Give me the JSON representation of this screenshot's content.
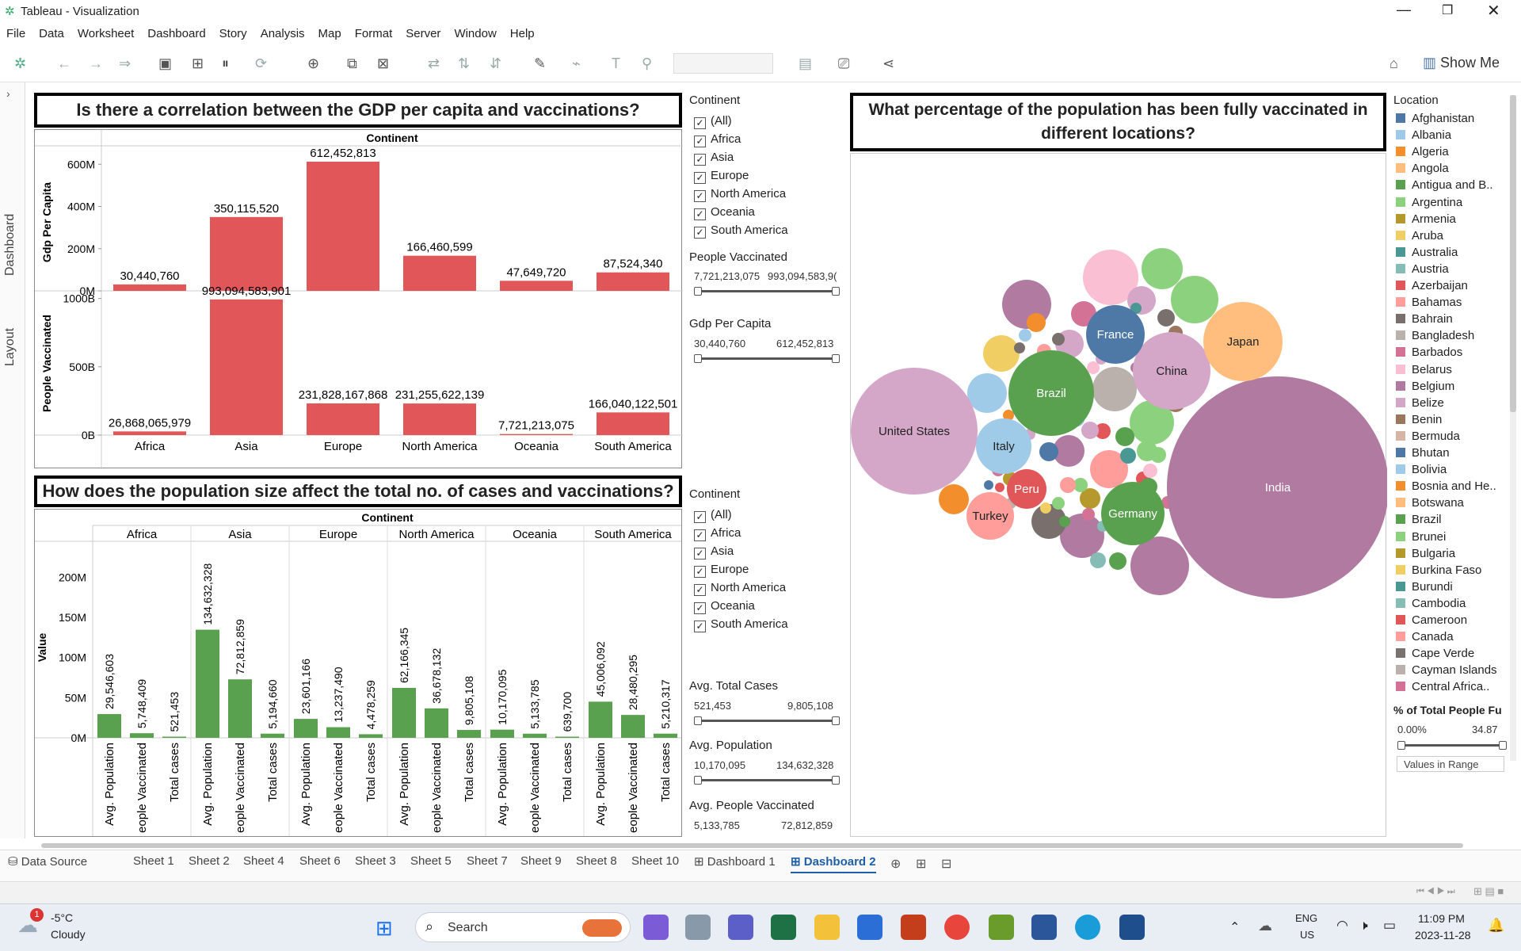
{
  "window": {
    "app_icon": "tableau-icon",
    "title": "Tableau - Visualization",
    "controls": [
      "minimize-icon",
      "restore-icon",
      "close-icon"
    ]
  },
  "menu": [
    "File",
    "Data",
    "Worksheet",
    "Dashboard",
    "Story",
    "Analysis",
    "Map",
    "Format",
    "Server",
    "Window",
    "Help"
  ],
  "toolbar": {
    "show_me": "Show Me"
  },
  "side_tabs": {
    "dashboard": "Dashboard",
    "layout": "Layout"
  },
  "viz1": {
    "title": "Is there a correlation between the GDP per capita and  vaccinations?",
    "header": "Continent",
    "chart_data": {
      "type": "bar",
      "categories": [
        "Africa",
        "Asia",
        "Europe",
        "North America",
        "Oceania",
        "South America"
      ],
      "series": [
        {
          "name": "Gdp Per Capita",
          "values": [
            30440760,
            350115520,
            612452813,
            166460599,
            47649720,
            87524340
          ],
          "labels": [
            "30,440,760",
            "350,115,520",
            "612,452,813",
            "166,460,599",
            "47,649,720",
            "87,524,340"
          ],
          "ticks": [
            "600M",
            "400M",
            "200M",
            "0M"
          ],
          "ymax": 650000000
        },
        {
          "name": "People Vaccinated",
          "values": [
            26868065979,
            993094583901,
            231828167868,
            231255622139,
            7721213075,
            166040122501
          ],
          "labels": [
            "26,868,065,979",
            "993,094,583,901",
            "231,828,167,868",
            "231,255,622,139",
            "7,721,213,075",
            "166,040,122,501"
          ],
          "ticks": [
            "1000B",
            "500B",
            "0B"
          ],
          "ymax": 1050000000000
        }
      ],
      "color": "#e15759"
    }
  },
  "viz2": {
    "title": "How does the population size affect the total no. of cases and vaccinations?",
    "header": "Continent",
    "ylabel": "Value",
    "chart_data": {
      "type": "bar",
      "categories": [
        "Africa",
        "Asia",
        "Europe",
        "North America",
        "Oceania",
        "South America"
      ],
      "measures": [
        "Avg. Population",
        "eople Vaccinated",
        "Total cases"
      ],
      "values": [
        [
          29546603,
          5748409,
          521453
        ],
        [
          134632328,
          72812859,
          5194660
        ],
        [
          23601166,
          13237490,
          4478259
        ],
        [
          62166345,
          36678132,
          9805108
        ],
        [
          10170095,
          5133785,
          639700
        ],
        [
          45006092,
          28480295,
          5210317
        ]
      ],
      "labels": [
        [
          "29,546,603",
          "5,748,409",
          "521,453"
        ],
        [
          "134,632,328",
          "72,812,859",
          "5,194,660"
        ],
        [
          "23,601,166",
          "13,237,490",
          "4,478,259"
        ],
        [
          "62,166,345",
          "36,678,132",
          "9,805,108"
        ],
        [
          "10,170,095",
          "5,133,785",
          "639,700"
        ],
        [
          "45,006,092",
          "28,480,295",
          "5,210,317"
        ]
      ],
      "ticks": [
        "200M",
        "150M",
        "100M",
        "50M",
        "0M"
      ],
      "ymax": 225000000,
      "color": "#59a14f"
    }
  },
  "filters1": {
    "continent_label": "Continent",
    "continents": [
      "(All)",
      "Africa",
      "Asia",
      "Europe",
      "North America",
      "Oceania",
      "South America"
    ],
    "people_vacc": {
      "label": "People Vaccinated",
      "min": "7,721,213,075",
      "max": "993,094,583,9("
    },
    "gdp": {
      "label": "Gdp Per Capita",
      "min": "30,440,760",
      "max": "612,452,813"
    }
  },
  "filters2": {
    "continent_label": "Continent",
    "continents": [
      "(All)",
      "Africa",
      "Asia",
      "Europe",
      "North America",
      "Oceania",
      "South America"
    ],
    "total_cases": {
      "label": "Avg. Total Cases",
      "min": "521,453",
      "max": "9,805,108"
    },
    "population": {
      "label": "Avg. Population",
      "min": "10,170,095",
      "max": "134,632,328"
    },
    "people_vacc": {
      "label": "Avg. People Vaccinated",
      "min": "5,133,785",
      "max": "72,812,859"
    }
  },
  "viz3": {
    "title": "What percentage of the population has been fully vaccinated in different locations?",
    "bubbles": [
      {
        "label": "India",
        "color": "#b07aa1"
      },
      {
        "label": "United States",
        "color": "#d4a6c8"
      },
      {
        "label": "Brazil",
        "color": "#59a14f"
      },
      {
        "label": "China",
        "color": "#d4a6c8"
      },
      {
        "label": "Japan",
        "color": "#ffbe7d"
      },
      {
        "label": "France",
        "color": "#4e79a7"
      },
      {
        "label": "Germany",
        "color": "#59a14f"
      },
      {
        "label": "Italy",
        "color": "#a0cbe8"
      },
      {
        "label": "Turkey",
        "color": "#ff9d9a"
      },
      {
        "label": "Peru",
        "color": "#e15759"
      }
    ]
  },
  "legend": {
    "title": "Location",
    "items": [
      {
        "name": "Afghanistan",
        "color": "#4e79a7"
      },
      {
        "name": "Albania",
        "color": "#a0cbe8"
      },
      {
        "name": "Algeria",
        "color": "#f28e2b"
      },
      {
        "name": "Angola",
        "color": "#ffbe7d"
      },
      {
        "name": "Antigua and B..",
        "color": "#59a14f"
      },
      {
        "name": "Argentina",
        "color": "#8cd17d"
      },
      {
        "name": "Armenia",
        "color": "#b6992d"
      },
      {
        "name": "Aruba",
        "color": "#f1ce63"
      },
      {
        "name": "Australia",
        "color": "#499894"
      },
      {
        "name": "Austria",
        "color": "#86bcb6"
      },
      {
        "name": "Azerbaijan",
        "color": "#e15759"
      },
      {
        "name": "Bahamas",
        "color": "#ff9d9a"
      },
      {
        "name": "Bahrain",
        "color": "#79706e"
      },
      {
        "name": "Bangladesh",
        "color": "#bab0ac"
      },
      {
        "name": "Barbados",
        "color": "#d37295"
      },
      {
        "name": "Belarus",
        "color": "#fabfd2"
      },
      {
        "name": "Belgium",
        "color": "#b07aa1"
      },
      {
        "name": "Belize",
        "color": "#d4a6c8"
      },
      {
        "name": "Benin",
        "color": "#9d7660"
      },
      {
        "name": "Bermuda",
        "color": "#d7b5a6"
      },
      {
        "name": "Bhutan",
        "color": "#4e79a7"
      },
      {
        "name": "Bolivia",
        "color": "#a0cbe8"
      },
      {
        "name": "Bosnia and He..",
        "color": "#f28e2b"
      },
      {
        "name": "Botswana",
        "color": "#ffbe7d"
      },
      {
        "name": "Brazil",
        "color": "#59a14f"
      },
      {
        "name": "Brunei",
        "color": "#8cd17d"
      },
      {
        "name": "Bulgaria",
        "color": "#b6992d"
      },
      {
        "name": "Burkina Faso",
        "color": "#f1ce63"
      },
      {
        "name": "Burundi",
        "color": "#499894"
      },
      {
        "name": "Cambodia",
        "color": "#86bcb6"
      },
      {
        "name": "Cameroon",
        "color": "#e15759"
      },
      {
        "name": "Canada",
        "color": "#ff9d9a"
      },
      {
        "name": "Cape Verde",
        "color": "#79706e"
      },
      {
        "name": "Cayman Islands",
        "color": "#bab0ac"
      },
      {
        "name": "Central Africa..",
        "color": "#d37295"
      }
    ],
    "pct_title": "% of Total People Fu",
    "pct_min": "0.00%",
    "pct_max": "34.87",
    "values_in_range": "Values in Range"
  },
  "sheet_tabs": [
    "Data Source",
    "Sheet 1",
    "Sheet 2",
    "Sheet 4",
    "Sheet 6",
    "Sheet 3",
    "Sheet 5",
    "Sheet 7",
    "Sheet 9",
    "Sheet 8",
    "Sheet 10",
    "Dashboard 1",
    "Dashboard 2"
  ],
  "active_tab": "Dashboard 2",
  "taskbar": {
    "temp": "-5°C",
    "weather": "Cloudy",
    "badge": "1",
    "search": "Search",
    "lang1": "ENG",
    "lang2": "US",
    "time": "11:09 PM",
    "date": "2023-11-28"
  }
}
